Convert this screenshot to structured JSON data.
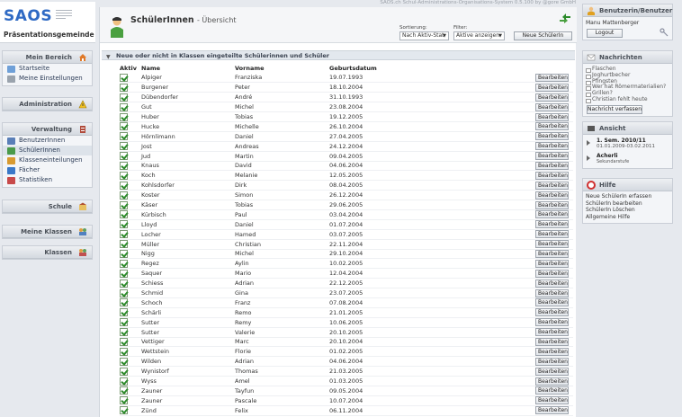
{
  "header": {
    "copyright": "SAOS.ch Schul-Administrations-Organisations-System 0.5.100 by @gore GmbH"
  },
  "brand": {
    "name": "SAOS",
    "school": "Präsentationsgemeinde"
  },
  "left_nav": {
    "mein_bereich": {
      "title": "Mein Bereich",
      "items": [
        "Startseite",
        "Meine Einstellungen"
      ]
    },
    "administration": {
      "title": "Administration"
    },
    "verwaltung": {
      "title": "Verwaltung",
      "items": [
        "BenutzerInnen",
        "SchülerInnen",
        "Klasseneinteilungen",
        "Fächer",
        "Statistiken"
      ]
    },
    "schule": {
      "title": "Schule"
    },
    "meine_klassen": {
      "title": "Meine Klassen"
    },
    "klassen": {
      "title": "Klassen"
    }
  },
  "page": {
    "title": "SchülerInnen",
    "subtitle": "- Übersicht",
    "sort_label": "Sortierung:",
    "sort_value": "Nach Aktiv-Stat",
    "filter_label": "Filter:",
    "filter_value": "Aktive anzeigen",
    "new_button": "Neue SchülerIn",
    "section_title": "Neue oder nicht in Klassen eingeteilte Schülerinnen und Schüler",
    "columns": {
      "aktiv": "Aktiv",
      "name": "Name",
      "vorname": "Vorname",
      "geburtsdatum": "Geburtsdatum"
    },
    "edit_label": "Bearbeiten"
  },
  "students": [
    {
      "name": "Alpiger",
      "vorname": "Franziska",
      "geb": "19.07.1993"
    },
    {
      "name": "Burgener",
      "vorname": "Peter",
      "geb": "18.10.2004"
    },
    {
      "name": "Dübendorfer",
      "vorname": "André",
      "geb": "31.10.1993"
    },
    {
      "name": "Gut",
      "vorname": "Michel",
      "geb": "23.08.2004"
    },
    {
      "name": "Huber",
      "vorname": "Tobias",
      "geb": "19.12.2005"
    },
    {
      "name": "Hucke",
      "vorname": "Michelle",
      "geb": "26.10.2004"
    },
    {
      "name": "Hörnlimann",
      "vorname": "Daniel",
      "geb": "27.04.2005"
    },
    {
      "name": "Jost",
      "vorname": "Andreas",
      "geb": "24.12.2004"
    },
    {
      "name": "Jud",
      "vorname": "Martin",
      "geb": "09.04.2005"
    },
    {
      "name": "Knaus",
      "vorname": "David",
      "geb": "04.06.2004"
    },
    {
      "name": "Koch",
      "vorname": "Melanie",
      "geb": "12.05.2005"
    },
    {
      "name": "Kohlsdorfer",
      "vorname": "Dirk",
      "geb": "08.04.2005"
    },
    {
      "name": "Koster",
      "vorname": "Simon",
      "geb": "26.12.2004"
    },
    {
      "name": "Käser",
      "vorname": "Tobias",
      "geb": "29.06.2005"
    },
    {
      "name": "Kürbisch",
      "vorname": "Paul",
      "geb": "03.04.2004"
    },
    {
      "name": "Lloyd",
      "vorname": "Daniel",
      "geb": "01.07.2004"
    },
    {
      "name": "Locher",
      "vorname": "Hamed",
      "geb": "03.07.2005"
    },
    {
      "name": "Müller",
      "vorname": "Christian",
      "geb": "22.11.2004"
    },
    {
      "name": "Nigg",
      "vorname": "Michel",
      "geb": "29.10.2004"
    },
    {
      "name": "Regez",
      "vorname": "Aylin",
      "geb": "10.02.2005"
    },
    {
      "name": "Saquer",
      "vorname": "Mario",
      "geb": "12.04.2004"
    },
    {
      "name": "Schiess",
      "vorname": "Adrian",
      "geb": "22.12.2005"
    },
    {
      "name": "Schmid",
      "vorname": "Gina",
      "geb": "23.07.2005"
    },
    {
      "name": "Schoch",
      "vorname": "Franz",
      "geb": "07.08.2004"
    },
    {
      "name": "Schärli",
      "vorname": "Remo",
      "geb": "21.01.2005"
    },
    {
      "name": "Sutter",
      "vorname": "Remy",
      "geb": "10.06.2005"
    },
    {
      "name": "Sutter",
      "vorname": "Valerie",
      "geb": "20.10.2005"
    },
    {
      "name": "Vettiger",
      "vorname": "Marc",
      "geb": "20.10.2004"
    },
    {
      "name": "Wettstein",
      "vorname": "Florie",
      "geb": "01.02.2005"
    },
    {
      "name": "Wilden",
      "vorname": "Adrian",
      "geb": "04.06.2004"
    },
    {
      "name": "Wynistorf",
      "vorname": "Thomas",
      "geb": "21.03.2005"
    },
    {
      "name": "Wyss",
      "vorname": "Amel",
      "geb": "01.03.2005"
    },
    {
      "name": "Zauner",
      "vorname": "Tayfun",
      "geb": "09.05.2004"
    },
    {
      "name": "Zauner",
      "vorname": "Pascale",
      "geb": "10.07.2004"
    },
    {
      "name": "Zünd",
      "vorname": "Felix",
      "geb": "06.11.2004"
    }
  ],
  "right": {
    "user": {
      "title": "Benutzerin/Benutzer",
      "name": "Manu Mattenberger",
      "logout": "Logout"
    },
    "news": {
      "title": "Nachrichten",
      "items": [
        "Flaschen",
        "Joghurtbecher",
        "Pfingsten",
        "Wer hat Römermaterialien?",
        "Grillen?",
        "Christian fehlt heute"
      ],
      "compose": "Nachricht verfassen"
    },
    "view": {
      "title": "Ansicht",
      "semester": "1. Sem. 2010/11",
      "semester_dates": "01.01.2009-03.02.2011",
      "place": "Acherli",
      "level": "Sekundarstufe"
    },
    "help": {
      "title": "Hilfe",
      "items": [
        "Neue SchülerIn erfassen",
        "SchülerIn bearbeiten",
        "SchülerIn Löschen",
        "Allgemeine Hilfe"
      ]
    }
  }
}
